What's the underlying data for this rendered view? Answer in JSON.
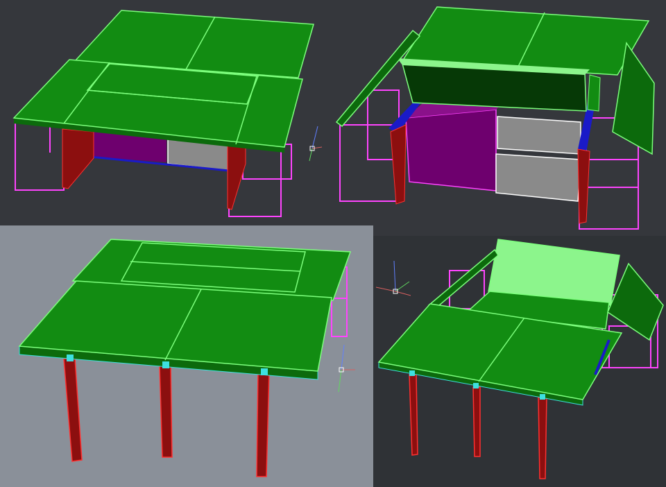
{
  "viewports": [
    {
      "id": "top-left",
      "background": "#35373c"
    },
    {
      "id": "top-right",
      "background": "#35373c"
    },
    {
      "id": "bottom-left",
      "background": "#8a9099"
    },
    {
      "id": "bottom-right",
      "background": "#2f3236"
    }
  ],
  "colors": {
    "top_face": "#128c12",
    "top_face_edge": "#7dff7d",
    "side_face": "#0c6a0c",
    "light_green": "#8cf58c",
    "dark_green_inner": "#063906",
    "leg": "#8c0f0f",
    "leg_edge": "#ff3030",
    "frame": "#ff44ff",
    "purple_panel": "#6e006e",
    "gray_drawer": "#8a8a8a",
    "white_edge": "#ffffff",
    "blue_rail": "#1a1ac8",
    "cyan_edge": "#3de0e0",
    "ucs_x": "#d86060",
    "ucs_y": "#60d860",
    "ucs_z": "#6080ff"
  }
}
